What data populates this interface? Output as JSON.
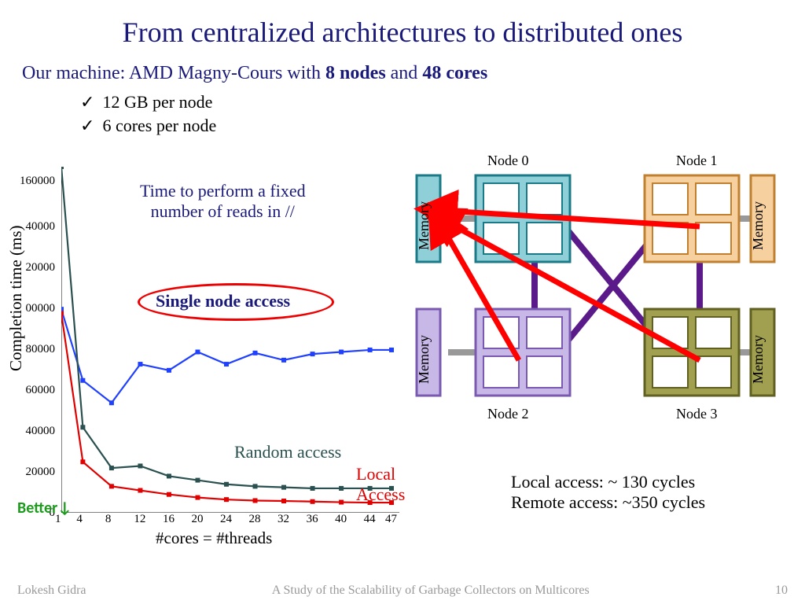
{
  "title": "From centralized architectures to distributed ones",
  "subtitle_prefix": "Our machine: AMD Magny-Cours with ",
  "subtitle_nodes": "8 nodes",
  "subtitle_and": " and ",
  "subtitle_cores": "48 cores",
  "bullet1": "12 GB per node",
  "bullet2": "6 cores per node",
  "chart_note_line1": "Time to perform a fixed",
  "chart_note_line2": "number of reads in //",
  "single_node_label": "Single node access",
  "random_access_label": "Random access",
  "local_access_line1": "Local",
  "local_access_line2": "Access",
  "better_label": "Better↓",
  "chart_ylabel": "Completion time (ms)",
  "chart_xlabel": "#cores = #threads",
  "local_cycles": "Local access: ~ 130 cycles",
  "remote_cycles": "Remote access: ~350 cycles",
  "node0": "Node 0",
  "node1": "Node 1",
  "node2": "Node 2",
  "node3": "Node 3",
  "memory_label": "Memory",
  "footer_left": "Lokesh Gidra",
  "footer_center": "A Study of the Scalability of Garbage Collectors on Multicores",
  "footer_right": "10",
  "chart_data": {
    "type": "line",
    "xlabel": "#cores = #threads",
    "ylabel": "Completion time (ms)",
    "ylim": [
      0,
      170000
    ],
    "x": [
      1,
      4,
      8,
      12,
      16,
      20,
      24,
      28,
      32,
      36,
      40,
      44,
      47
    ],
    "series": [
      {
        "name": "Single node access",
        "color": "#2040ff",
        "values": [
          100000,
          65000,
          54000,
          73000,
          70000,
          79000,
          73000,
          78500,
          75000,
          78000,
          79000,
          80000,
          80000
        ]
      },
      {
        "name": "Random access",
        "color": "#2a5050",
        "values": [
          170000,
          42000,
          22000,
          23000,
          18000,
          16000,
          14000,
          13000,
          12500,
          12000,
          12000,
          12000,
          12000
        ]
      },
      {
        "name": "Local Access",
        "color": "#e00000",
        "values": [
          98000,
          25000,
          13000,
          11000,
          9000,
          7500,
          6500,
          6000,
          5800,
          5500,
          5200,
          5000,
          5000
        ]
      }
    ],
    "xticks": [
      1,
      4,
      8,
      12,
      16,
      20,
      24,
      28,
      32,
      36,
      40,
      44,
      47
    ],
    "yticks": [
      0,
      20000,
      40000,
      60000,
      80000,
      100000,
      120000,
      140000,
      160000
    ],
    "ytick_labels": [
      "0",
      "20000",
      "40000",
      "60000",
      "80000",
      "00000",
      "20000",
      "40000",
      "160000"
    ]
  }
}
